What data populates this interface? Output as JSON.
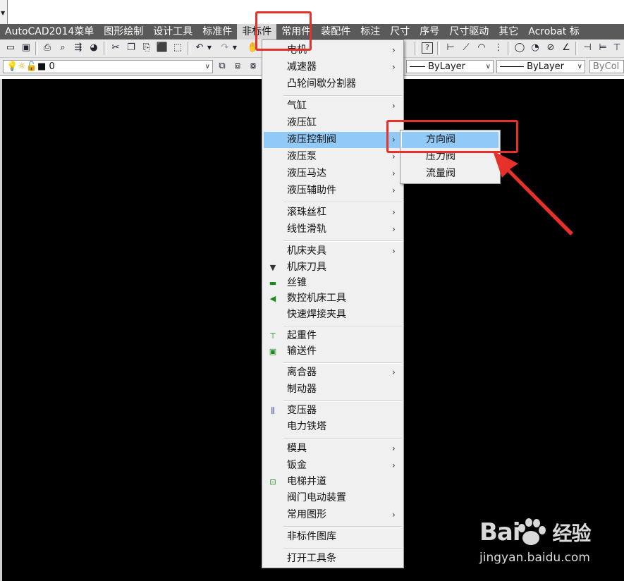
{
  "menubar": {
    "items": [
      "AutoCAD2014菜单",
      "图形绘制",
      "设计工具",
      "标准件",
      "非标件",
      "常用件",
      "装配件",
      "标注",
      "尺寸",
      "序号",
      "尺寸驱动",
      "其它",
      "Acrobat 标"
    ],
    "active_index": 4
  },
  "toolbar2": {
    "layer_value": "0",
    "linetype_value": "ByLayer",
    "lineweight_value": "ByLayer",
    "color_value": "ByCol"
  },
  "menu": {
    "items": [
      {
        "label": "电机",
        "submenu": true,
        "icon": ""
      },
      {
        "label": "减速器",
        "submenu": true,
        "icon": ""
      },
      {
        "label": "凸轮间歇分割器",
        "submenu": false,
        "icon": ""
      },
      {
        "label": "气缸",
        "submenu": true,
        "icon": ""
      },
      {
        "label": "液压缸",
        "submenu": false,
        "icon": ""
      },
      {
        "label": "液压控制阀",
        "submenu": true,
        "icon": "",
        "highlighted": true
      },
      {
        "label": "液压泵",
        "submenu": true,
        "icon": ""
      },
      {
        "label": "液压马达",
        "submenu": true,
        "icon": ""
      },
      {
        "label": "液压辅助件",
        "submenu": true,
        "icon": ""
      },
      {
        "label": "滚珠丝杠",
        "submenu": true,
        "icon": ""
      },
      {
        "label": "线性滑轨",
        "submenu": true,
        "icon": ""
      },
      {
        "label": "机床夹具",
        "submenu": true,
        "icon": ""
      },
      {
        "label": "机床刀具",
        "submenu": false,
        "icon": "tool-bit-icon"
      },
      {
        "label": "丝锥",
        "submenu": false,
        "icon": "tap-icon"
      },
      {
        "label": "数控机床工具",
        "submenu": false,
        "icon": "cnc-tool-icon"
      },
      {
        "label": "快速焊接夹具",
        "submenu": false,
        "icon": ""
      },
      {
        "label": "起重件",
        "submenu": false,
        "icon": "hoist-icon"
      },
      {
        "label": "输送件",
        "submenu": false,
        "icon": "conveyor-icon"
      },
      {
        "label": "离合器",
        "submenu": true,
        "icon": ""
      },
      {
        "label": "制动器",
        "submenu": false,
        "icon": ""
      },
      {
        "label": "变压器",
        "submenu": false,
        "icon": "transformer-icon"
      },
      {
        "label": "电力铁塔",
        "submenu": false,
        "icon": ""
      },
      {
        "label": "模具",
        "submenu": true,
        "icon": ""
      },
      {
        "label": "钣金",
        "submenu": true,
        "icon": ""
      },
      {
        "label": "电梯井道",
        "submenu": false,
        "icon": "elevator-shaft-icon"
      },
      {
        "label": "阀门电动装置",
        "submenu": false,
        "icon": ""
      },
      {
        "label": "常用图形",
        "submenu": true,
        "icon": ""
      },
      {
        "label": "非标件图库",
        "submenu": false,
        "icon": ""
      },
      {
        "label": "打开工具条",
        "submenu": false,
        "icon": ""
      }
    ]
  },
  "submenu": {
    "items": [
      {
        "label": "方向阀",
        "highlighted": true
      },
      {
        "label": "压力阀",
        "highlighted": false
      },
      {
        "label": "流量阀",
        "highlighted": false
      }
    ]
  },
  "watermark": {
    "logo": "Bai",
    "logo_suffix": "经验",
    "url": "jingyan.baidu.com"
  },
  "colors": {
    "menubar_bg": "#5a5a5a",
    "highlight": "#91c9f7",
    "annotation_red": "#e8302a",
    "canvas_bg": "#000000"
  }
}
